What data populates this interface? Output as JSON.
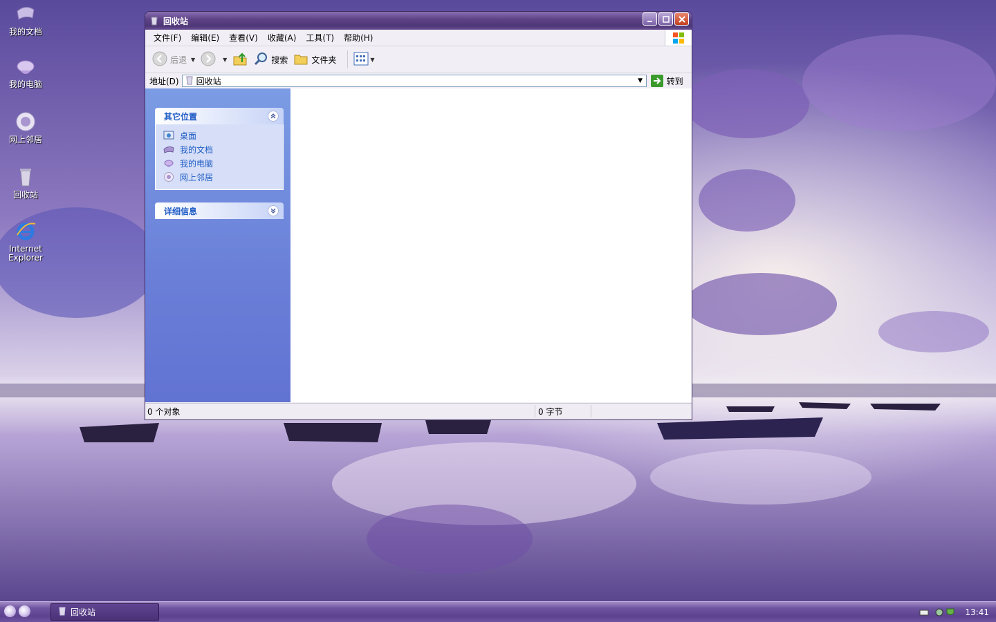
{
  "desktop": {
    "icons": [
      {
        "label": "我的文档",
        "icon": "my-documents-icon"
      },
      {
        "label": "我的电脑",
        "icon": "my-computer-icon"
      },
      {
        "label": "网上邻居",
        "icon": "network-places-icon"
      },
      {
        "label": "回收站",
        "icon": "recycle-bin-icon"
      },
      {
        "label_line1": "Internet",
        "label_line2": "Explorer",
        "icon": "internet-explorer-icon"
      }
    ]
  },
  "window": {
    "title": "回收站",
    "menu": [
      "文件(F)",
      "编辑(E)",
      "查看(V)",
      "收藏(A)",
      "工具(T)",
      "帮助(H)"
    ],
    "toolbar": {
      "back": "后退",
      "search": "搜索",
      "folders": "文件夹"
    },
    "address": {
      "label": "地址(D)",
      "value": "回收站",
      "go": "转到"
    },
    "taskpane": {
      "other_places": {
        "title": "其它位置",
        "links": [
          {
            "label": "桌面",
            "icon": "desktop-icon"
          },
          {
            "label": "我的文档",
            "icon": "my-documents-icon"
          },
          {
            "label": "我的电脑",
            "icon": "my-computer-icon"
          },
          {
            "label": "网上邻居",
            "icon": "network-places-icon"
          }
        ]
      },
      "details": {
        "title": "详细信息"
      }
    },
    "status": {
      "objects": "0 个对象",
      "bytes": "0 字节"
    }
  },
  "taskbar": {
    "task": "回收站",
    "clock": "13:41"
  },
  "colors": {
    "titlebar": "#5f4488",
    "taskpane": "#6a7fd8",
    "link": "#215dc6",
    "taskbar": "#5d4290"
  }
}
